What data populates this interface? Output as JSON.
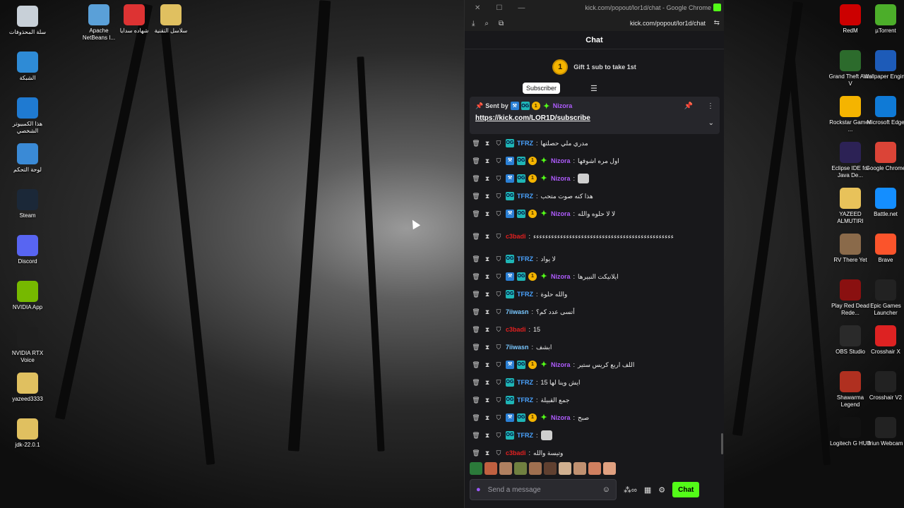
{
  "desktop_left": [
    {
      "label": "سلة المحذوفات",
      "icon": "recycle-bin-icon",
      "color": "#c8d0d8"
    },
    {
      "label": "الشبكة",
      "icon": "network-icon",
      "color": "#2e8bd6"
    },
    {
      "label": "هذا الكمبيوتر الشخصي",
      "icon": "computer-icon",
      "color": "#1f7ad1"
    },
    {
      "label": "لوحة التحكم",
      "icon": "control-panel-icon",
      "color": "#3a8ad6"
    },
    {
      "label": "Steam",
      "icon": "steam-icon",
      "color": "#1b2838"
    },
    {
      "label": "Discord",
      "icon": "discord-icon",
      "color": "#5865f2"
    },
    {
      "label": "NVIDIA App",
      "icon": "nvidia-icon",
      "color": "#76b900"
    },
    {
      "label": "NVIDIA RTX Voice",
      "icon": "nvidia-voice-icon",
      "color": "#1e1e1e"
    },
    {
      "label": "yazeed3333",
      "icon": "folder-zip-icon",
      "color": "#e0c060"
    },
    {
      "label": "jdk-22.0.1",
      "icon": "folder-zip-icon",
      "color": "#e0c060"
    }
  ],
  "desktop_top": [
    {
      "label": "Apache NetBeans I...",
      "icon": "netbeans-icon",
      "color": "#5aa0d8"
    },
    {
      "label": "شهاده سدايا",
      "icon": "pdf-icon",
      "color": "#d33"
    },
    {
      "label": "سلاسل التقنية",
      "icon": "folder-zip-icon",
      "color": "#e0c060"
    }
  ],
  "desktop_right": [
    {
      "label": "RedM",
      "icon": "redm-icon",
      "color": "#c00"
    },
    {
      "label": "Grand Theft Auto V",
      "icon": "gta-icon",
      "color": "#2c6b2c"
    },
    {
      "label": "Rockstar Games ...",
      "icon": "rockstar-icon",
      "color": "#f5b400"
    },
    {
      "label": "Eclipse IDE for Java De...",
      "icon": "eclipse-icon",
      "color": "#2c2255"
    },
    {
      "label": "YAZEED ALMUTIRI",
      "icon": "folder-icon",
      "color": "#e8c25a"
    },
    {
      "label": "RV There Yet",
      "icon": "rv-icon",
      "color": "#8a6a4a"
    },
    {
      "label": "Play Red Dead Rede...",
      "icon": "rdr-icon",
      "color": "#8a1010"
    },
    {
      "label": "OBS Studio",
      "icon": "obs-icon",
      "color": "#2a2a2a"
    },
    {
      "label": "Shawarma Legend",
      "icon": "shawarma-icon",
      "color": "#b03020"
    },
    {
      "label": "Logitech G HUB",
      "icon": "logitech-icon",
      "color": "#111"
    }
  ],
  "desktop_right2": [
    {
      "label": "µTorrent",
      "icon": "utorrent-icon",
      "color": "#4cae2a"
    },
    {
      "label": "Wallpaper Engine",
      "icon": "wallpaper-engine-icon",
      "color": "#1d5bb8"
    },
    {
      "label": "Microsoft Edge",
      "icon": "edge-icon",
      "color": "#0f7ad6"
    },
    {
      "label": "Google Chrome",
      "icon": "chrome-icon",
      "color": "#db4437"
    },
    {
      "label": "Battle.net",
      "icon": "battlenet-icon",
      "color": "#148eff"
    },
    {
      "label": "Brave",
      "icon": "brave-icon",
      "color": "#fb542b"
    },
    {
      "label": "Epic Games Launcher",
      "icon": "epic-icon",
      "color": "#222"
    },
    {
      "label": "Crosshair X",
      "icon": "crosshair-icon",
      "color": "#d22"
    },
    {
      "label": "Crosshair V2",
      "icon": "crosshair-icon",
      "color": "#222"
    },
    {
      "label": "Iriun Webcam",
      "icon": "webcam-icon",
      "color": "#222"
    }
  ],
  "browser": {
    "title": "kick.com/popout/lor1d/chat - Google Chrome",
    "url": "kick.com/popout/lor1d/chat"
  },
  "chat": {
    "header": "Chat",
    "gift_count": "1",
    "gift_text": "Gift 1 sub to take 1st",
    "tooltip": "Subscriber",
    "pinned": {
      "sent_by": "Sent by",
      "user": "Nizora",
      "link": "https://kick.com/LOR1D/subscribe"
    },
    "messages": [
      {
        "user": "TFRZ",
        "cls": "u-tfrz",
        "badges": [
          "teal"
        ],
        "text": "مدري ملي حصلتها"
      },
      {
        "user": "Nizora",
        "cls": "u-nizora",
        "badges": [
          "blue",
          "teal",
          "gold",
          "green"
        ],
        "text": "اول مره اشوفها"
      },
      {
        "user": "Nizora",
        "cls": "u-nizora",
        "badges": [
          "blue",
          "teal",
          "gold",
          "green"
        ],
        "text": "",
        "emote": true
      },
      {
        "user": "TFRZ",
        "cls": "u-tfrz",
        "badges": [
          "teal"
        ],
        "text": "هذا كنه صوت متحب"
      },
      {
        "user": "Nizora",
        "cls": "u-nizora",
        "badges": [
          "blue",
          "teal",
          "gold",
          "green"
        ],
        "text": "لا لا حلوه والله"
      },
      {
        "user": "c3badi",
        "cls": "u-c3",
        "badges": [],
        "text": "ءءءءءءءءءءءءءءءءءءءءءءءءءءءءءءءءءءءءءءءءءءءءءءء"
      },
      {
        "user": "TFRZ",
        "cls": "u-tfrz",
        "badges": [
          "teal"
        ],
        "text": "لا يواد"
      },
      {
        "user": "Nizora",
        "cls": "u-nizora",
        "badges": [
          "blue",
          "teal",
          "gold",
          "green"
        ],
        "text": "ايلانيكت النبيرها"
      },
      {
        "user": "TFRZ",
        "cls": "u-tfrz",
        "badges": [
          "teal"
        ],
        "text": "والله حلوة"
      },
      {
        "user": "7iiwasn",
        "cls": "u-7ii",
        "badges": [],
        "text": "أتسى عدد كم؟"
      },
      {
        "user": "c3badi",
        "cls": "u-c3",
        "badges": [],
        "text": "15"
      },
      {
        "user": "7iiwasn",
        "cls": "u-7ii",
        "badges": [],
        "text": "ابشف"
      },
      {
        "user": "Nizora",
        "cls": "u-nizora",
        "badges": [
          "blue",
          "teal",
          "gold",
          "green"
        ],
        "text": "اللف اربع كريس ستير"
      },
      {
        "user": "TFRZ",
        "cls": "u-tfrz",
        "badges": [
          "teal"
        ],
        "text": "ايش وينا لها 15"
      },
      {
        "user": "TFRZ",
        "cls": "u-tfrz",
        "badges": [
          "teal"
        ],
        "text": "جمع القبيلة"
      },
      {
        "user": "Nizora",
        "cls": "u-nizora",
        "badges": [
          "blue",
          "teal",
          "gold",
          "green"
        ],
        "text": "صبح"
      },
      {
        "user": "TFRZ",
        "cls": "u-tfrz",
        "badges": [
          "teal"
        ],
        "text": "",
        "emote": true
      },
      {
        "user": "c3badi",
        "cls": "u-c3",
        "badges": [],
        "text": "وتيسة والله"
      }
    ],
    "composer": {
      "placeholder": "Send a message",
      "send_label": "Chat"
    }
  }
}
